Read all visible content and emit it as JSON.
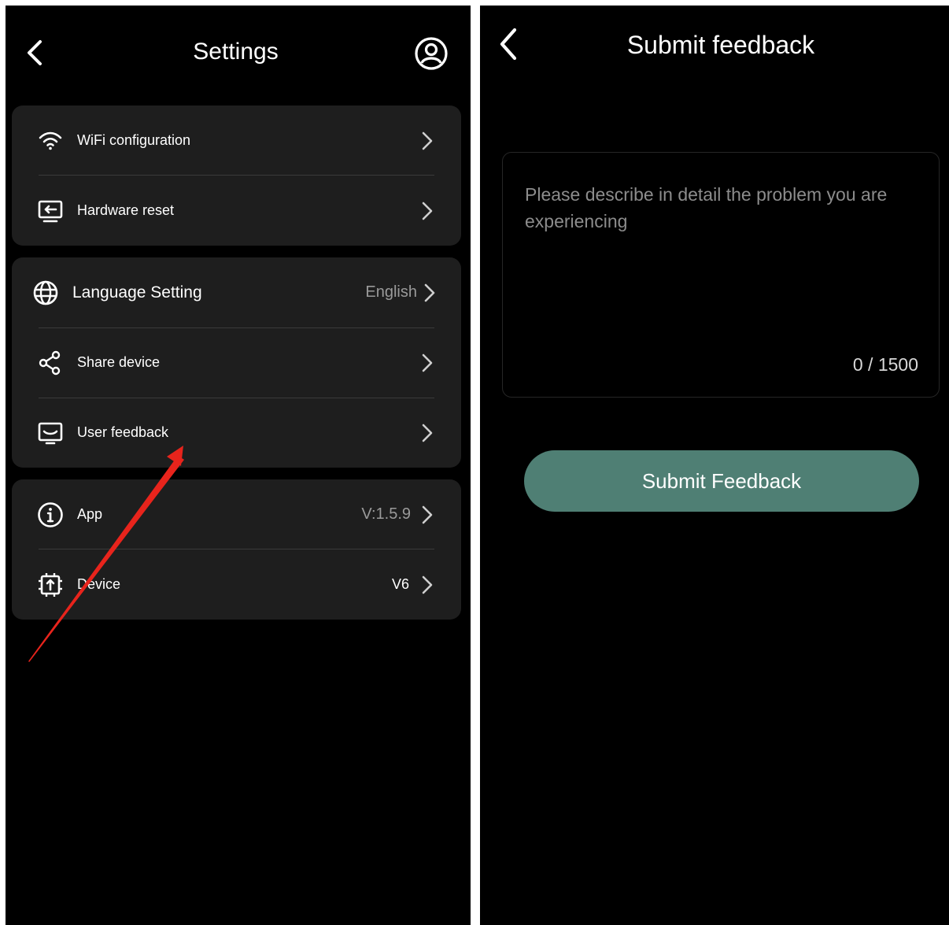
{
  "settings_screen": {
    "title": "Settings",
    "back_icon": "chevron-left-icon",
    "profile_icon": "user-circle-icon",
    "groups": [
      {
        "items": [
          {
            "label": "WiFi configuration",
            "icon": "wifi-icon",
            "value": ""
          },
          {
            "label": "Hardware reset",
            "icon": "hardware-reset-icon",
            "value": ""
          }
        ]
      },
      {
        "items": [
          {
            "label": "Language Setting",
            "icon": "globe-icon",
            "value": "English"
          },
          {
            "label": "Share device",
            "icon": "share-icon",
            "value": ""
          },
          {
            "label": "User feedback",
            "icon": "feedback-icon",
            "value": ""
          }
        ]
      },
      {
        "items": [
          {
            "label": "App",
            "icon": "info-icon",
            "value": "V:1.5.9"
          },
          {
            "label": "Device",
            "icon": "chip-upgrade-icon",
            "value": "V6"
          }
        ]
      }
    ]
  },
  "feedback_screen": {
    "title": "Submit feedback",
    "back_icon": "chevron-left-icon",
    "input_placeholder": "Please describe in detail the problem you are experiencing",
    "input_value": "",
    "counter": "0 / 1500",
    "submit_label": "Submit Feedback"
  },
  "colors": {
    "background": "#000000",
    "card": "#1e1e1e",
    "accent_button": "#4f7f74",
    "annotation_arrow": "#e8241c"
  }
}
